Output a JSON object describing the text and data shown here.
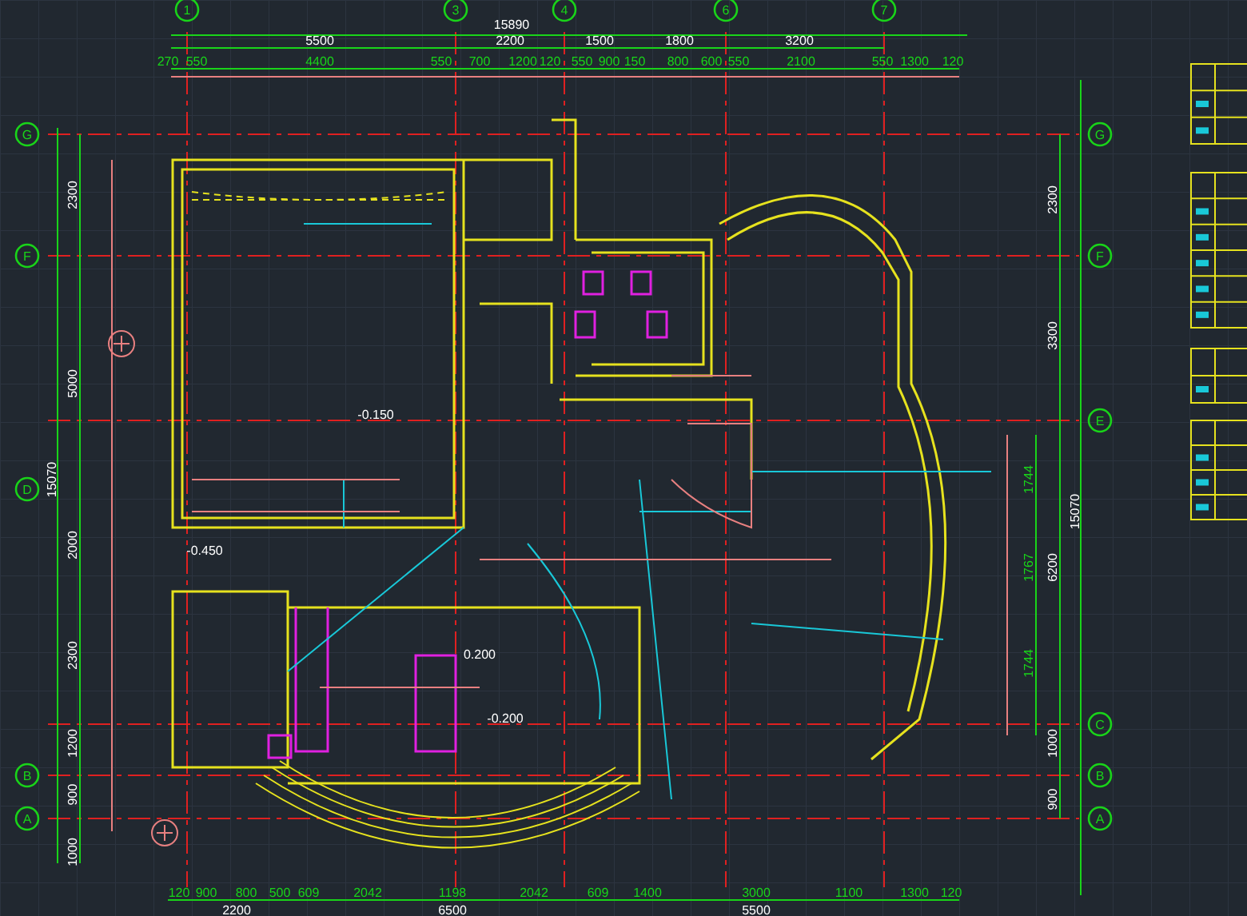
{
  "top_axes": [
    "1",
    "3",
    "4",
    "6",
    "7"
  ],
  "left_axes": [
    "G",
    "F",
    "D",
    "B",
    "A"
  ],
  "right_axes": [
    "G",
    "F",
    "E",
    "C",
    "B",
    "A"
  ],
  "top_dimensions": {
    "overall": "15890",
    "bays": [
      "5500",
      "2200",
      "1500",
      "1800",
      "3200"
    ],
    "details": [
      "270",
      "550",
      "4400",
      "550",
      "700",
      "1200",
      "120",
      "550",
      "900",
      "150",
      "800",
      "600",
      "550",
      "2100",
      "550",
      "1300",
      "120"
    ]
  },
  "left_dimensions": {
    "overall": "15070",
    "bays": [
      "2300",
      "5000",
      "2000",
      "2300",
      "1200",
      "900",
      "1000"
    ]
  },
  "right_dimensions": {
    "overall": "15070",
    "bays": [
      "2300",
      "3300",
      "6200",
      "1000",
      "900"
    ],
    "arc_segments": [
      "1744",
      "1767",
      "1744"
    ]
  },
  "bottom_dimensions": {
    "details": [
      "120",
      "900",
      "800",
      "500",
      "609",
      "2042",
      "1198",
      "2042",
      "609",
      "1400",
      "3000",
      "1100",
      "1300",
      "120"
    ],
    "bays": [
      "2200",
      "6500",
      "5500"
    ]
  },
  "level_marks": [
    "-0.150",
    "-0.450",
    "0.200",
    "-0.200"
  ]
}
